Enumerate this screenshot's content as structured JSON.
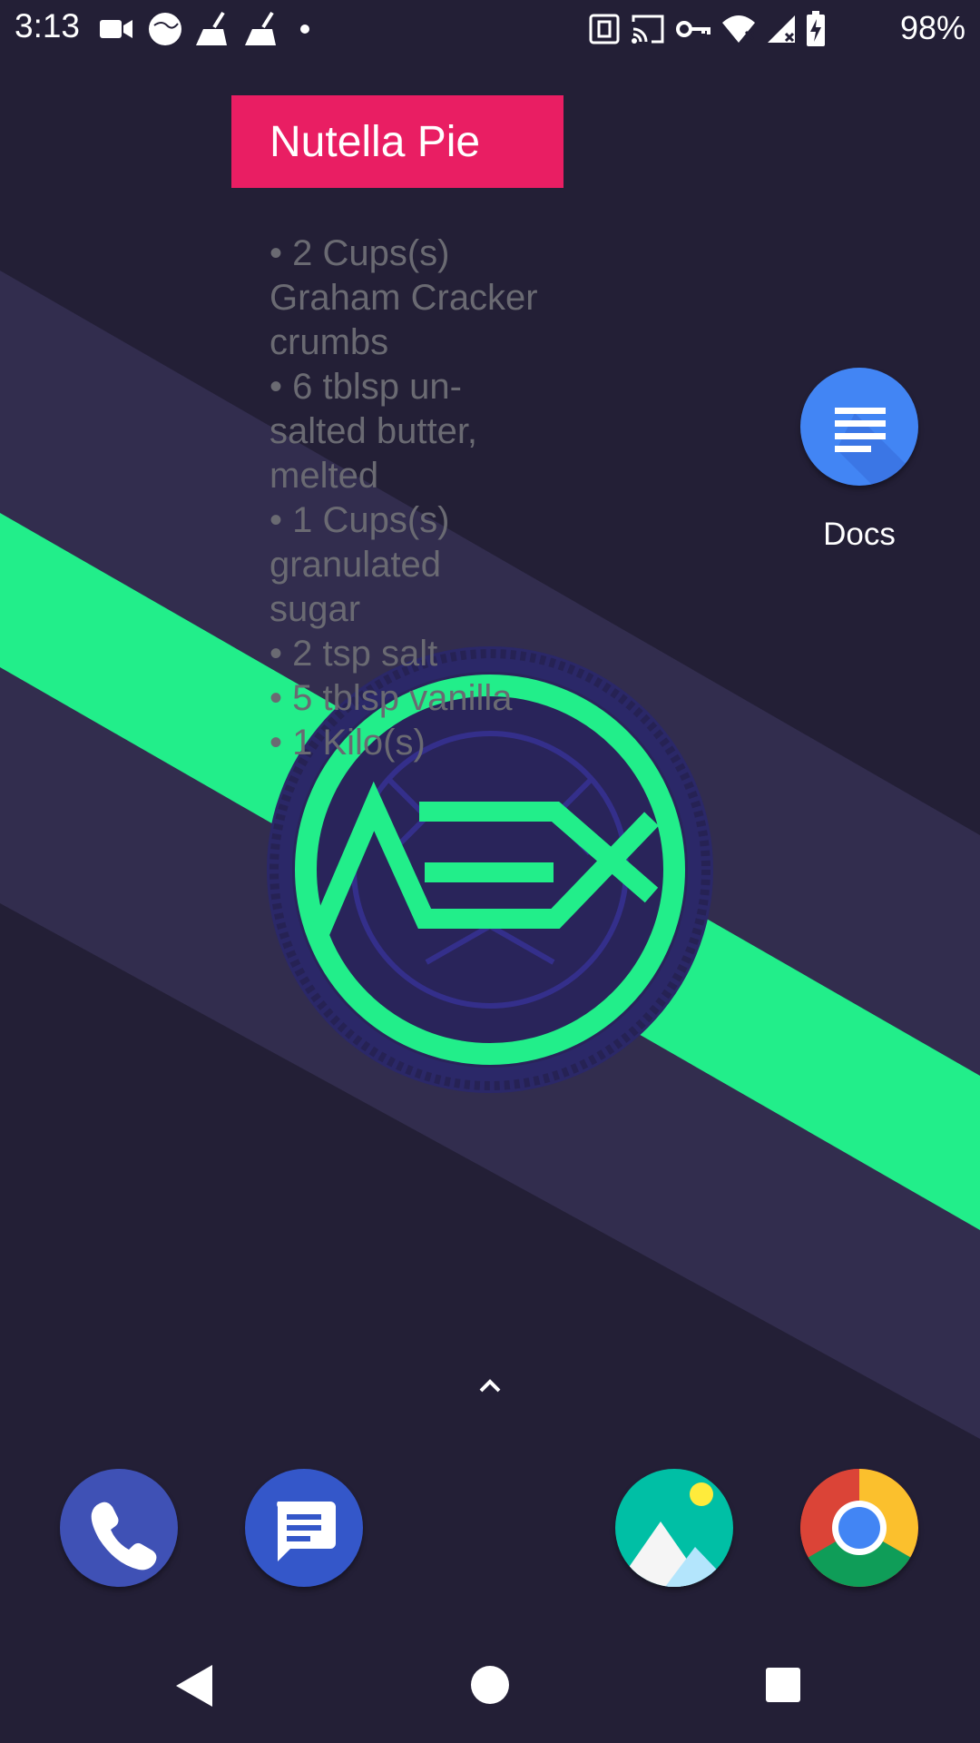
{
  "status_bar": {
    "time": "3:13",
    "battery_percent": "98%",
    "left_icons": [
      "video-camera-icon",
      "world-icon",
      "broom-icon",
      "broom-icon",
      "notification-dot-icon"
    ],
    "right_icons": [
      "nfc-icon",
      "cast-icon",
      "vpn-key-icon",
      "wifi-icon",
      "cell-signal-icon",
      "battery-charging-icon"
    ]
  },
  "widget": {
    "title": "Nutella Pie",
    "ingredients": [
      "• 2 Cups(s) Graham Cracker crumbs",
      "• 6 tblsp un-salted butter, melted",
      "• 1 Cups(s) granulated sugar",
      "• 2 tsp salt",
      "• 5 tblsp vanilla",
      "• 1 Kilo(s)"
    ]
  },
  "home_apps": [
    {
      "name": "Docs",
      "icon": "docs-icon",
      "color": "#4285f4"
    }
  ],
  "dock": [
    {
      "icon": "phone-icon",
      "color": "#3f51b5"
    },
    {
      "icon": "messages-icon",
      "color": "#3457c9"
    },
    {
      "icon": "gallery-icon",
      "color": "#00bfa5"
    },
    {
      "icon": "chrome-icon",
      "color": "#db4437"
    }
  ],
  "nav_bar": [
    "back-icon",
    "home-icon",
    "recents-icon"
  ],
  "colors": {
    "background": "#231f36",
    "stripe": "#322d4e",
    "accent": "#22ee8a",
    "widget_header": "#e91e63"
  }
}
